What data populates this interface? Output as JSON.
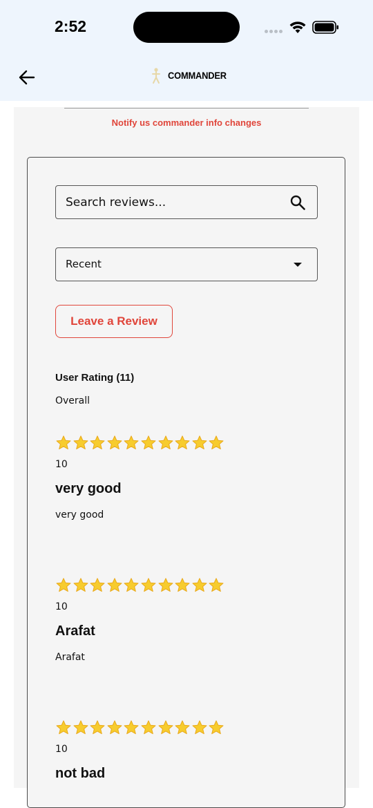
{
  "status_bar": {
    "time": "2:52"
  },
  "header": {
    "title": "COMMANDER",
    "back_icon": "arrow-left-icon",
    "logo_icon": "commander-logo-icon"
  },
  "notify_link": "Notify us commander info changes",
  "search": {
    "placeholder": "Search reviews...",
    "value": ""
  },
  "sort": {
    "selected": "Recent"
  },
  "leave_review_label": "Leave a Review",
  "rating_summary": {
    "heading": "User Rating (11)",
    "overall_label": "Overall"
  },
  "colors": {
    "accent": "#e0453a",
    "star": "#f7cc2e",
    "header_bg": "#eef5fd",
    "panel_bg": "#f5f5f5"
  },
  "reviews": [
    {
      "stars": 10,
      "score": "10",
      "title": "very good",
      "body": "very good"
    },
    {
      "stars": 10,
      "score": "10",
      "title": "Arafat",
      "body": "Arafat"
    },
    {
      "stars": 10,
      "score": "10",
      "title": "not bad",
      "body": ""
    }
  ]
}
